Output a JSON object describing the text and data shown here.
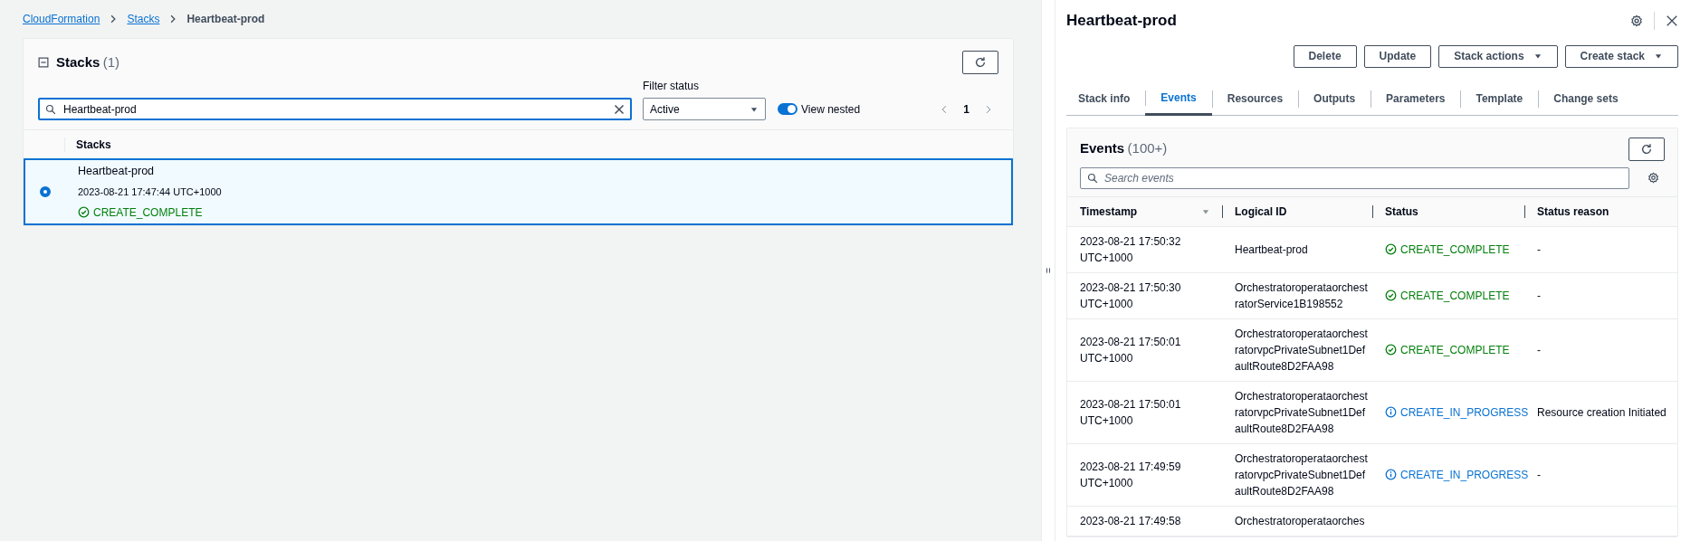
{
  "breadcrumbs": [
    {
      "label": "CloudFormation",
      "link": true
    },
    {
      "label": "Stacks",
      "link": true
    },
    {
      "label": "Heartbeat-prod",
      "link": false
    }
  ],
  "stacks_panel": {
    "title": "Stacks",
    "count": "(1)",
    "search": {
      "value": "Heartbeat-prod"
    },
    "filter": {
      "label": "Filter status",
      "value": "Active"
    },
    "view_nested": {
      "label": "View nested",
      "on": true
    },
    "pagination": {
      "page": "1"
    },
    "column": "Stacks",
    "rows": [
      {
        "name": "Heartbeat-prod",
        "created": "2023-08-21 17:47:44 UTC+1000",
        "status": {
          "kind": "success",
          "text": "CREATE_COMPLETE"
        },
        "selected": true
      }
    ]
  },
  "detail": {
    "title": "Heartbeat-prod",
    "buttons": [
      {
        "label": "Delete",
        "dropdown": false
      },
      {
        "label": "Update",
        "dropdown": false
      },
      {
        "label": "Stack actions",
        "dropdown": true
      },
      {
        "label": "Create stack",
        "dropdown": true
      }
    ],
    "tabs": [
      {
        "label": "Stack info",
        "selected": false
      },
      {
        "label": "Events",
        "selected": true
      },
      {
        "label": "Resources",
        "selected": false
      },
      {
        "label": "Outputs",
        "selected": false
      },
      {
        "label": "Parameters",
        "selected": false
      },
      {
        "label": "Template",
        "selected": false
      },
      {
        "label": "Change sets",
        "selected": false
      }
    ],
    "events": {
      "title": "Events",
      "count": "(100+)",
      "search": {
        "placeholder": "Search events"
      },
      "columns": [
        {
          "label": "Timestamp",
          "sorted": true
        },
        {
          "label": "Logical ID",
          "sorted": false
        },
        {
          "label": "Status",
          "sorted": false
        },
        {
          "label": "Status reason",
          "sorted": false
        }
      ],
      "rows": [
        {
          "timestamp": "2023-08-21 17:50:32 UTC+1000",
          "logical_id": "Heartbeat-prod",
          "status": {
            "kind": "success",
            "text": "CREATE_COMPLETE"
          },
          "reason": "-"
        },
        {
          "timestamp": "2023-08-21 17:50:30 UTC+1000",
          "logical_id": "OrchestratoroperataorchestratorService1B198552",
          "status": {
            "kind": "success",
            "text": "CREATE_COMPLETE"
          },
          "reason": "-"
        },
        {
          "timestamp": "2023-08-21 17:50:01 UTC+1000",
          "logical_id": "OrchestratoroperataorchestratorvpcPrivateSubnet1DefaultRoute8D2FAA98",
          "status": {
            "kind": "success",
            "text": "CREATE_COMPLETE"
          },
          "reason": "-"
        },
        {
          "timestamp": "2023-08-21 17:50:01 UTC+1000",
          "logical_id": "OrchestratoroperataorchestratorvpcPrivateSubnet1DefaultRoute8D2FAA98",
          "status": {
            "kind": "info",
            "text": "CREATE_IN_PROGRESS"
          },
          "reason": "Resource creation Initiated"
        },
        {
          "timestamp": "2023-08-21 17:49:59 UTC+1000",
          "logical_id": "OrchestratoroperataorchestratorvpcPrivateSubnet1DefaultRoute8D2FAA98",
          "status": {
            "kind": "info",
            "text": "CREATE_IN_PROGRESS"
          },
          "reason": "-"
        },
        {
          "timestamp": "2023-08-21 17:49:58",
          "logical_id": "Orchestratoroperataorches"
        }
      ]
    }
  }
}
